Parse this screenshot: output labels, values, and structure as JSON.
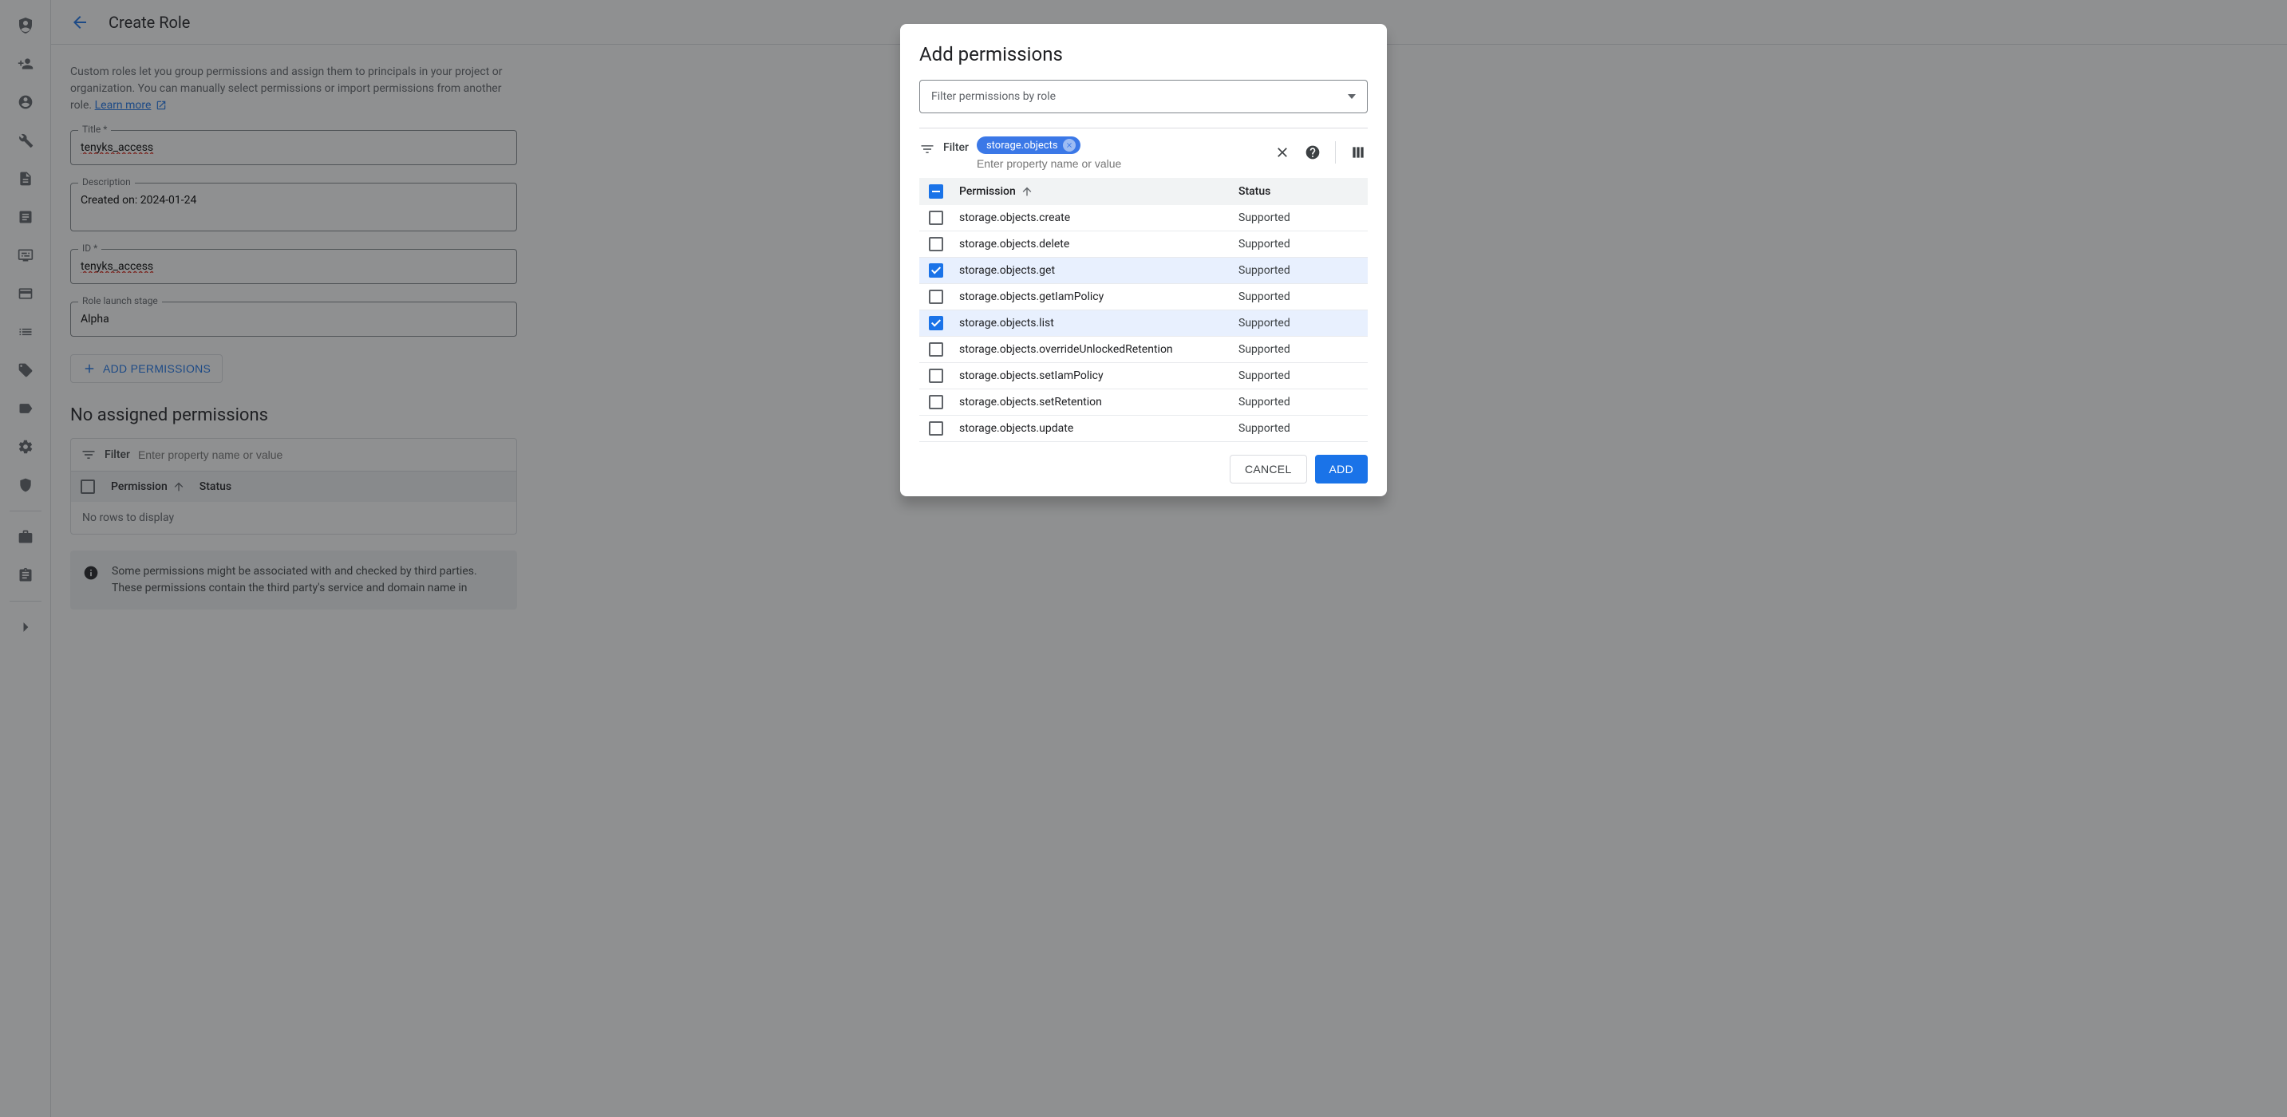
{
  "nav_icons": [
    "security-icon",
    "add-user-icon",
    "user-circle-icon",
    "wrench-icon",
    "document-list-icon",
    "doc-icon",
    "display-settings-icon",
    "card-icon",
    "list-icon",
    "tag-icon",
    "label-icon",
    "gear-icon",
    "shield-icon"
  ],
  "header": {
    "title": "Create Role"
  },
  "intro": {
    "text_truncated": "Custom roles let you group permissions and assign them to principals in your project or organization. You can manually select permissions or import permissions from another role.",
    "learn_more": "Learn more"
  },
  "form": {
    "title_label": "Title *",
    "title_value": "tenyks_access",
    "description_label": "Description",
    "description_value": "Created on: 2024-01-24",
    "id_label": "ID *",
    "id_value": "tenyks_access",
    "stage_label": "Role launch stage",
    "stage_value": "Alpha",
    "add_perm_btn": "ADD PERMISSIONS"
  },
  "perm_section": {
    "heading": "No assigned permissions",
    "filter_label": "Filter",
    "filter_placeholder": "Enter property name or value",
    "col_permission": "Permission",
    "col_status": "Status",
    "no_rows": "No rows to display"
  },
  "info_box": {
    "text": "Some permissions might be associated with and checked by third parties. These permissions contain the third party's service and domain name in"
  },
  "dialog": {
    "title": "Add permissions",
    "role_select_placeholder": "Filter permissions by role",
    "filter_label": "Filter",
    "chip_text": "storage.objects",
    "prop_placeholder": "Enter property name or value",
    "col_permission": "Permission",
    "col_status": "Status",
    "rows": [
      {
        "name": "storage.objects.create",
        "status": "Supported",
        "checked": false
      },
      {
        "name": "storage.objects.delete",
        "status": "Supported",
        "checked": false
      },
      {
        "name": "storage.objects.get",
        "status": "Supported",
        "checked": true
      },
      {
        "name": "storage.objects.getIamPolicy",
        "status": "Supported",
        "checked": false
      },
      {
        "name": "storage.objects.list",
        "status": "Supported",
        "checked": true
      },
      {
        "name": "storage.objects.overrideUnlockedRetention",
        "status": "Supported",
        "checked": false
      },
      {
        "name": "storage.objects.setIamPolicy",
        "status": "Supported",
        "checked": false
      },
      {
        "name": "storage.objects.setRetention",
        "status": "Supported",
        "checked": false
      },
      {
        "name": "storage.objects.update",
        "status": "Supported",
        "checked": false
      }
    ],
    "cancel": "CANCEL",
    "add": "ADD"
  }
}
